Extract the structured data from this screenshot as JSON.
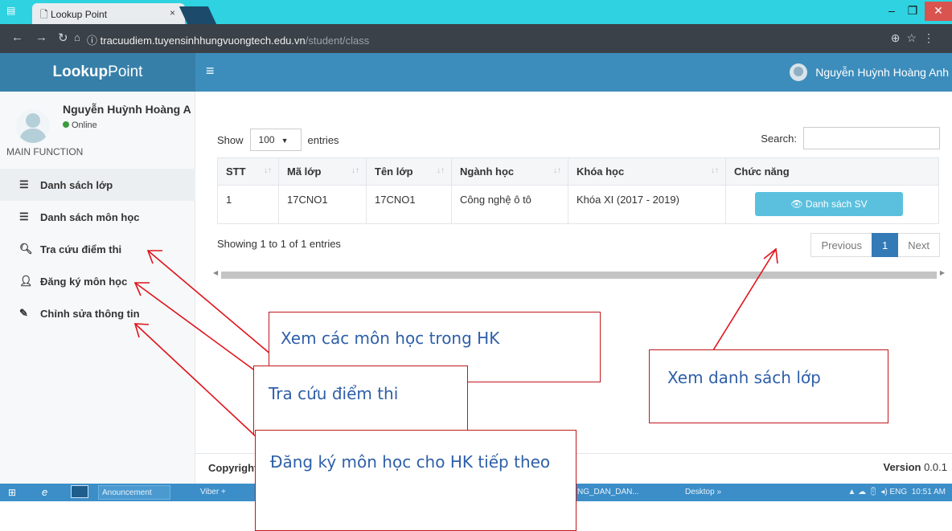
{
  "browser": {
    "tab_title": "Lookup Point",
    "tab_close": "×",
    "url_host": "tracuudiem.tuyensinhhungvuongtech.edu.vn",
    "url_path": "/student/class",
    "win_min": "–",
    "win_max": "❐",
    "win_close": "✕"
  },
  "header": {
    "logo_bold": "Lookup",
    "logo_rest": "Point",
    "menu_icon": "≡",
    "user_name": "Nguyễn Huỳnh Hoàng Anh"
  },
  "sidebar": {
    "user_name": "Nguyễn Huỳnh Hoàng A",
    "status": "Online",
    "section_header": "MAIN FUNCTION",
    "items": [
      {
        "label": "Danh sách lớp",
        "icon": "list-icon"
      },
      {
        "label": "Danh sách môn học",
        "icon": "list-icon"
      },
      {
        "label": "Tra cứu điểm thi",
        "icon": "search-icon"
      },
      {
        "label": "Đăng ký môn học",
        "icon": "user-plus-icon"
      },
      {
        "label": "Chỉnh sửa thông tin",
        "icon": "edit-icon"
      }
    ]
  },
  "table_controls": {
    "show_label": "Show",
    "page_size": "100",
    "entries_label": "entries",
    "search_label": "Search:",
    "search_value": ""
  },
  "table": {
    "headers": [
      "STT",
      "Mã lớp",
      "Tên lớp",
      "Ngành học",
      "Khóa học",
      "Chức năng"
    ],
    "rows": [
      {
        "stt": "1",
        "ma_lop": "17CNO1",
        "ten_lop": "17CNO1",
        "nganh_hoc": "Công nghệ ô tô",
        "khoa_hoc": "Khóa XI (2017 - 2019)",
        "action": "Danh sách SV"
      }
    ]
  },
  "pagination": {
    "info": "Showing 1 to 1 of 1 entries",
    "previous": "Previous",
    "current": "1",
    "next": "Next"
  },
  "footer": {
    "copyright": "Copyright",
    "version_label": "Version",
    "version_value": "0.0.1"
  },
  "taskbar": {
    "start": "⊞",
    "ie": "e",
    "announcement": "Anouncement",
    "viber": "Viber +",
    "doc": "NG_DAN_DAN...",
    "desktop": "Desktop",
    "lang": "ENG",
    "time": "10:51 AM"
  },
  "annotations": {
    "callout_1": "Xem các môn học trong HK",
    "callout_2": "Tra cứu điểm thi",
    "callout_3": "Đăng ký môn học cho HK tiếp theo",
    "callout_4": "Xem danh sách lớp",
    "arrow_color": "#e0141b"
  },
  "colors": {
    "header": "#3c8dbc",
    "logo_bg": "#367fa9",
    "tabbar": "#2fd2e0",
    "button_info": "#5bc0de",
    "pager_active": "#337ab7",
    "taskbar": "#3b8ec8"
  }
}
